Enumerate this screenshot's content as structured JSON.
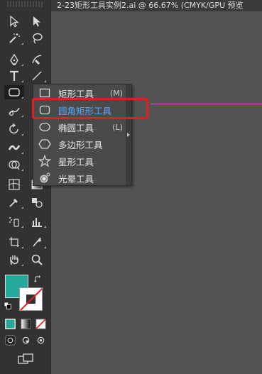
{
  "document": {
    "tab_title": "2-23矩形工具实例2.ai @ 66.67% (CMYK/GPU 预览"
  },
  "flyout": {
    "items": [
      {
        "label": "矩形工具",
        "shortcut": "(M)",
        "icon": "rectangle-icon"
      },
      {
        "label": "圆角矩形工具",
        "shortcut": "",
        "icon": "rounded-rectangle-icon"
      },
      {
        "label": "椭圆工具",
        "shortcut": "(L)",
        "icon": "ellipse-icon"
      },
      {
        "label": "多边形工具",
        "shortcut": "",
        "icon": "polygon-icon"
      },
      {
        "label": "星形工具",
        "shortcut": "",
        "icon": "star-icon"
      },
      {
        "label": "光晕工具",
        "shortcut": "",
        "icon": "flare-icon"
      }
    ],
    "selected_index": 1
  },
  "colors": {
    "fill": "#26a99b",
    "stroke_none_slash": "#e02020",
    "guide": "#d44fd8",
    "highlight": "#59a8ff",
    "annotation_box": "#e02020"
  },
  "tools": [
    "selection-tool-icon",
    "direct-selection-tool-icon",
    "magic-wand-tool-icon",
    "lasso-tool-icon",
    "pen-tool-icon",
    "curvature-tool-icon",
    "type-tool-icon",
    "line-segment-tool-icon",
    "rectangle-tool-icon",
    "paintbrush-tool-icon",
    "shaper-tool-icon",
    "pencil-tool-icon",
    "rotate-tool-icon",
    "scale-tool-icon",
    "width-tool-icon",
    "free-transform-tool-icon",
    "shape-builder-tool-icon",
    "perspective-grid-tool-icon",
    "mesh-tool-icon",
    "gradient-tool-icon",
    "eyedropper-tool-icon",
    "blend-tool-icon",
    "symbol-sprayer-tool-icon",
    "column-graph-tool-icon",
    "artboard-tool-icon",
    "slice-tool-icon",
    "hand-tool-icon",
    "zoom-tool-icon"
  ]
}
